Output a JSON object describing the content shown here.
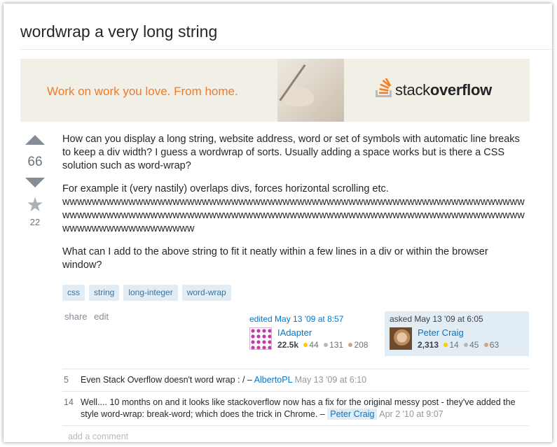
{
  "question": {
    "title": "wordwrap a very long string",
    "votes": "66",
    "favorites": "22",
    "body": [
      "How can you display a long string, website address, word or set of symbols with automatic line breaks to keep a div width? I guess a wordwrap of sorts. Usually adding a space works but is there a CSS solution such as word-wrap?",
      "For example it (very nastily) overlaps divs, forces horizontal scrolling etc.",
      "wwwwwwwwwwwwwwwwwwwwwwwwwwwwwwwwwwwwwwwwwwwwwwwwwwwwwwwwwwwwwwwwwwwwwwwwwwwwwwwwwwwwwwwwwwwwwwwwwwwwwwwwwwwwwwwwwwwwwwwwwwwwwwwwwwwwwwwwwwwwwwww",
      "What can I add to the above string to fit it neatly within a few lines in a div or within the browser window?"
    ],
    "tags": [
      "css",
      "string",
      "long-integer",
      "word-wrap"
    ],
    "actions": {
      "share": "share",
      "edit": "edit"
    }
  },
  "ad": {
    "tagline": "Work on work you love. From home.",
    "brand_light": "stack",
    "brand_bold": "overflow",
    "colors": {
      "tagline": "#ef7b2a",
      "logo": "#f48024",
      "background": "#f2efe7"
    }
  },
  "edited": {
    "time": "edited May 13 '09 at 8:57",
    "user": "IAdapter",
    "rep": "22.5k",
    "gold": "44",
    "silver": "131",
    "bronze": "208"
  },
  "asked": {
    "time": "asked May 13 '09 at 6:05",
    "user": "Peter Craig",
    "rep": "2,313",
    "gold": "14",
    "silver": "45",
    "bronze": "63"
  },
  "comments": [
    {
      "score": "5",
      "text": "Even Stack Overflow doesn't word wrap : / –",
      "user": "AlbertoPL",
      "date": "May 13 '09 at 6:10"
    },
    {
      "score": "14",
      "text": "Well.... 10 months on and it looks like stackoverflow now has a fix for the original messy post - they've added the style word-wrap: break-word; which does the trick in Chrome. –",
      "user": "Peter Craig",
      "date": "Apr 2 '10 at 9:07"
    }
  ],
  "add_comment": "add a comment"
}
